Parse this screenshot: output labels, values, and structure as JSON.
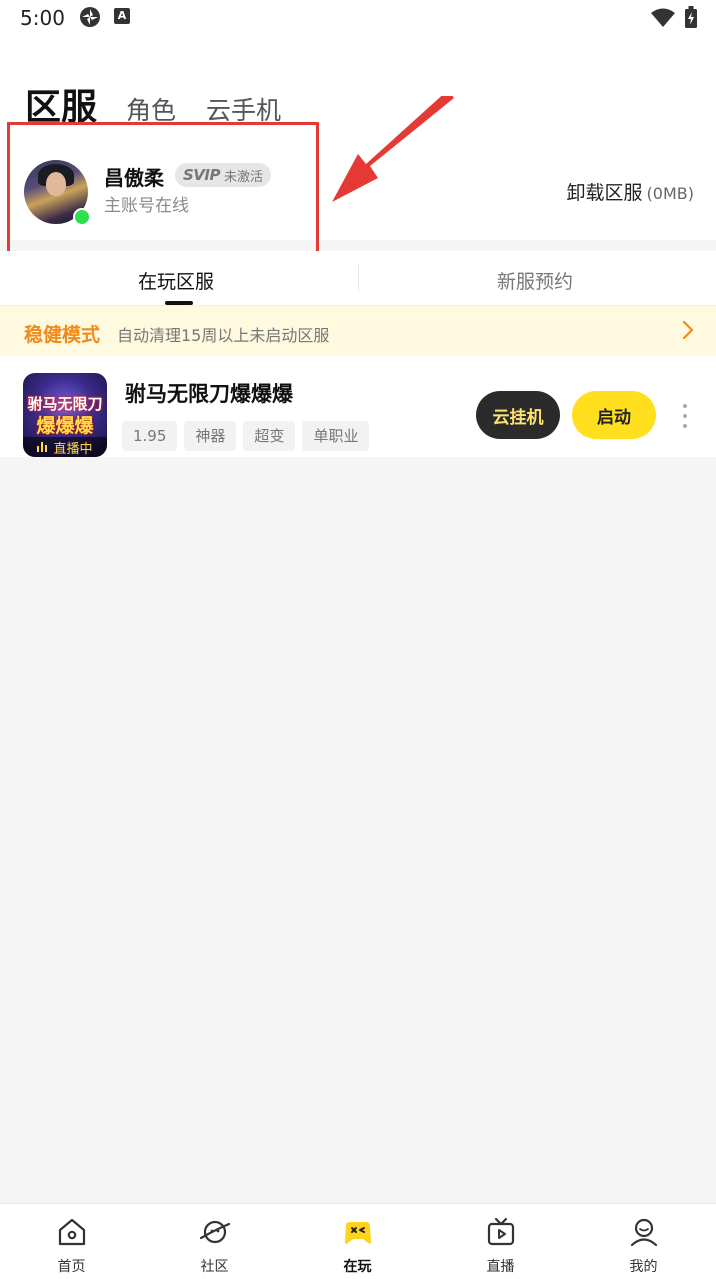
{
  "status_bar": {
    "time": "5:00",
    "icon_a": "A"
  },
  "header": {
    "tabs": [
      {
        "label": "区服",
        "active": true
      },
      {
        "label": "角色",
        "active": false
      },
      {
        "label": "云手机",
        "active": false
      }
    ]
  },
  "account": {
    "name": "昌傲柔",
    "svip_label": "SVIP",
    "svip_status": "未激活",
    "status": "主账号在线",
    "online_color": "#2ee04f"
  },
  "uninstall": {
    "label": "卸载区服",
    "size": "(0MB)"
  },
  "sub_tabs": [
    {
      "label": "在玩区服",
      "active": true
    },
    {
      "label": "新服预约",
      "active": false
    }
  ],
  "notice": {
    "mode": "稳健模式",
    "description": "自动清理15周以上未启动区服",
    "accent_color": "#f08b19"
  },
  "games": [
    {
      "title": "驸马无限刀爆爆爆",
      "icon_text_top": "驸马无限刀",
      "icon_text_bottom": "爆爆爆",
      "live_label": "直播中",
      "tags": [
        "1.95",
        "神器",
        "超变",
        "单职业"
      ],
      "cloud_button": "云挂机",
      "start_button": "启动"
    }
  ],
  "bottom_nav": [
    {
      "label": "首页",
      "icon": "home-icon",
      "active": false
    },
    {
      "label": "社区",
      "icon": "planet-icon",
      "active": false
    },
    {
      "label": "在玩",
      "icon": "gamepad-icon",
      "active": true
    },
    {
      "label": "直播",
      "icon": "tv-icon",
      "active": false
    },
    {
      "label": "我的",
      "icon": "profile-icon",
      "active": false
    }
  ],
  "colors": {
    "brand_yellow": "#ffdf1e",
    "highlight_red": "#e53935"
  }
}
